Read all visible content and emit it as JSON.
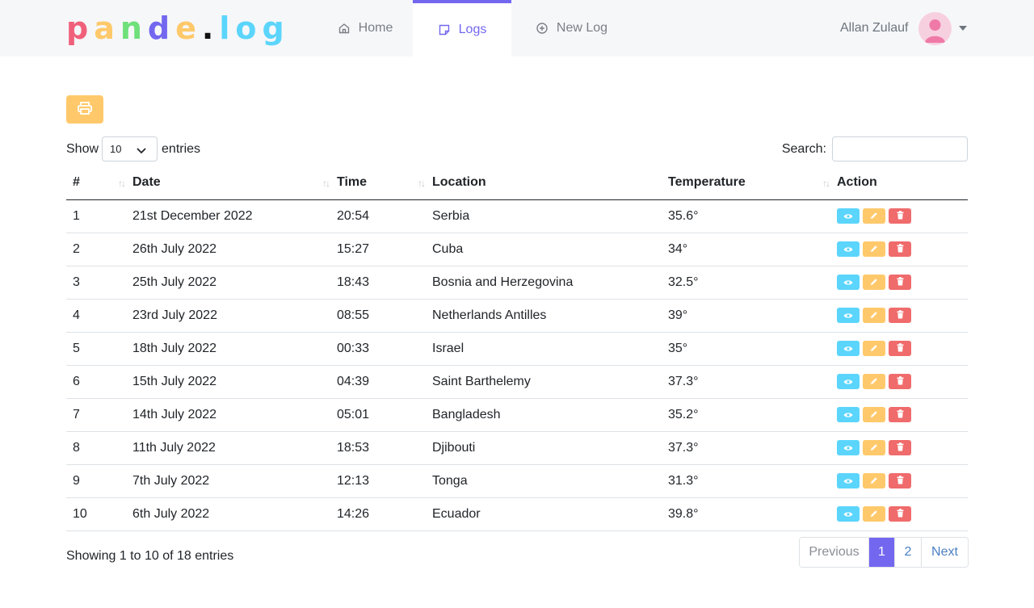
{
  "brand": {
    "letters": [
      {
        "ch": "p",
        "color": "#f0607a"
      },
      {
        "ch": "a",
        "color": "#ffc96b"
      },
      {
        "ch": "n",
        "color": "#6fe07a"
      },
      {
        "ch": "d",
        "color": "#7367f0"
      },
      {
        "ch": "e",
        "color": "#ffc96b"
      },
      {
        "ch": ".",
        "color": "#111111"
      },
      {
        "ch": "l",
        "color": "#5bd5fc"
      },
      {
        "ch": "o",
        "color": "#5bd5fc"
      },
      {
        "ch": "g",
        "color": "#5bd5fc"
      }
    ]
  },
  "nav": {
    "home": "Home",
    "logs": "Logs",
    "new_log": "New Log"
  },
  "user": {
    "name": "Allan Zulauf"
  },
  "table_controls": {
    "show": "Show",
    "entries_value": "10",
    "entries": "entries",
    "search_label": "Search:",
    "search_value": ""
  },
  "columns": [
    "#",
    "Date",
    "Time",
    "Location",
    "Temperature",
    "Action"
  ],
  "rows": [
    {
      "n": "1",
      "date": "21st December 2022",
      "time": "20:54",
      "location": "Serbia",
      "temp": "35.6°"
    },
    {
      "n": "2",
      "date": "26th July 2022",
      "time": "15:27",
      "location": "Cuba",
      "temp": "34°"
    },
    {
      "n": "3",
      "date": "25th July 2022",
      "time": "18:43",
      "location": "Bosnia and Herzegovina",
      "temp": "32.5°"
    },
    {
      "n": "4",
      "date": "23rd July 2022",
      "time": "08:55",
      "location": "Netherlands Antilles",
      "temp": "39°"
    },
    {
      "n": "5",
      "date": "18th July 2022",
      "time": "00:33",
      "location": "Israel",
      "temp": "35°"
    },
    {
      "n": "6",
      "date": "15th July 2022",
      "time": "04:39",
      "location": "Saint Barthelemy",
      "temp": "37.3°"
    },
    {
      "n": "7",
      "date": "14th July 2022",
      "time": "05:01",
      "location": "Bangladesh",
      "temp": "35.2°"
    },
    {
      "n": "8",
      "date": "11th July 2022",
      "time": "18:53",
      "location": "Djibouti",
      "temp": "37.3°"
    },
    {
      "n": "9",
      "date": "7th July 2022",
      "time": "12:13",
      "location": "Tonga",
      "temp": "31.3°"
    },
    {
      "n": "10",
      "date": "6th July 2022",
      "time": "14:26",
      "location": "Ecuador",
      "temp": "39.8°"
    }
  ],
  "footer": {
    "info": "Showing 1 to 10 of 18 entries",
    "previous": "Previous",
    "page1": "1",
    "page2": "2",
    "next": "Next"
  },
  "colors": {
    "accent": "#7367f0",
    "view": "#5bd5fc",
    "edit": "#ffc96b",
    "delete": "#f06b6b"
  }
}
